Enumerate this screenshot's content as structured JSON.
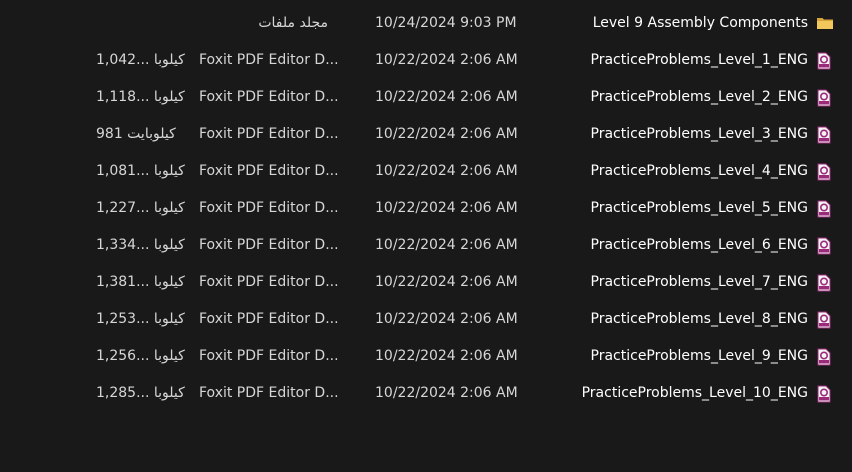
{
  "rows": [
    {
      "name": "Level 9 Assembly Components",
      "icon": "folder-icon",
      "date": "10/24/2024 9:03 PM",
      "type": "مجلد ملفات",
      "size": ""
    },
    {
      "name": "PracticeProblems_Level_1_ENG",
      "icon": "pdf-file-icon",
      "date": "10/22/2024 2:06 AM",
      "type": "Foxit PDF Editor D...",
      "size": "1,042... كيلوبا"
    },
    {
      "name": "PracticeProblems_Level_2_ENG",
      "icon": "pdf-file-icon",
      "date": "10/22/2024 2:06 AM",
      "type": "Foxit PDF Editor D...",
      "size": "1,118... كيلوبا"
    },
    {
      "name": "PracticeProblems_Level_3_ENG",
      "icon": "pdf-file-icon",
      "date": "10/22/2024 2:06 AM",
      "type": "Foxit PDF Editor D...",
      "size": "981 كيلوبايت"
    },
    {
      "name": "PracticeProblems_Level_4_ENG",
      "icon": "pdf-file-icon",
      "date": "10/22/2024 2:06 AM",
      "type": "Foxit PDF Editor D...",
      "size": "1,081... كيلوبا"
    },
    {
      "name": "PracticeProblems_Level_5_ENG",
      "icon": "pdf-file-icon",
      "date": "10/22/2024 2:06 AM",
      "type": "Foxit PDF Editor D...",
      "size": "1,227... كيلوبا"
    },
    {
      "name": "PracticeProblems_Level_6_ENG",
      "icon": "pdf-file-icon",
      "date": "10/22/2024 2:06 AM",
      "type": "Foxit PDF Editor D...",
      "size": "1,334... كيلوبا"
    },
    {
      "name": "PracticeProblems_Level_7_ENG",
      "icon": "pdf-file-icon",
      "date": "10/22/2024 2:06 AM",
      "type": "Foxit PDF Editor D...",
      "size": "1,381... كيلوبا"
    },
    {
      "name": "PracticeProblems_Level_8_ENG",
      "icon": "pdf-file-icon",
      "date": "10/22/2024 2:06 AM",
      "type": "Foxit PDF Editor D...",
      "size": "1,253... كيلوبا"
    },
    {
      "name": "PracticeProblems_Level_9_ENG",
      "icon": "pdf-file-icon",
      "date": "10/22/2024 2:06 AM",
      "type": "Foxit PDF Editor D...",
      "size": "1,256... كيلوبا"
    },
    {
      "name": "PracticeProblems_Level_10_ENG",
      "icon": "pdf-file-icon",
      "date": "10/22/2024 2:06 AM",
      "type": "Foxit PDF Editor D...",
      "size": "1,285... كيلوبا"
    }
  ],
  "colors": {
    "background": "#191919",
    "folder": "#e8b84a",
    "pdf_accent": "#9c2a7a"
  }
}
